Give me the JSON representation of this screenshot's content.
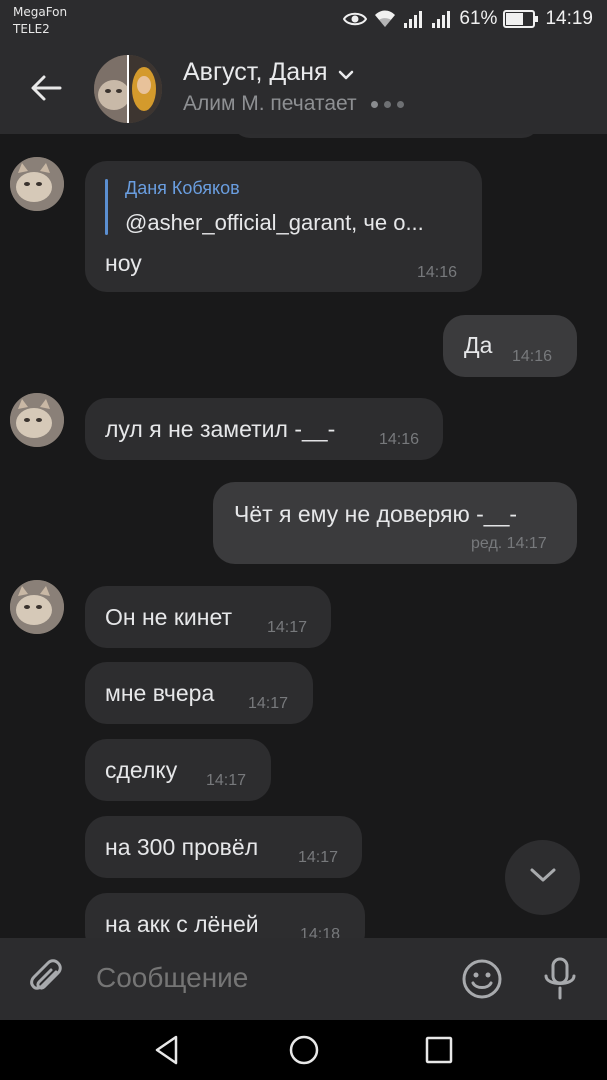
{
  "status_bar": {
    "carrier_1": "MegaFon",
    "carrier_2": "TELE2",
    "battery": "61%",
    "time": "14:19"
  },
  "header": {
    "title": "Август, Даня",
    "subtitle": "Алим М. печатает"
  },
  "messages": [
    {
      "side": "in",
      "reply_author": "Даня Кобяков",
      "reply_text": "@asher_official_garant, че о...",
      "text": "ноу",
      "time": "14:16"
    },
    {
      "side": "out",
      "text": "Да",
      "time": "14:16"
    },
    {
      "side": "in",
      "text": "лул я не заметил -__-",
      "time": "14:16"
    },
    {
      "side": "out",
      "text": "Чёт я ему не доверяю -__-",
      "time": "ред. 14:17"
    },
    {
      "side": "in",
      "text": "Он не кинет",
      "time": "14:17"
    },
    {
      "side": "in",
      "text": "мне вчера",
      "time": "14:17"
    },
    {
      "side": "in",
      "text": "сделку",
      "time": "14:17"
    },
    {
      "side": "in",
      "text": "на 300 провёл",
      "time": "14:17"
    },
    {
      "side": "in",
      "text": "на акк с лёней",
      "time": "14:18"
    }
  ],
  "composer": {
    "placeholder": "Сообщение"
  },
  "icons": {
    "back": "arrow-left-icon",
    "attach": "paperclip-icon",
    "emoji": "smiley-icon",
    "mic": "microphone-icon",
    "scroll_down": "chevron-down-icon"
  },
  "colors": {
    "bar_bg": "#2c2c2e",
    "chat_bg": "#19191a",
    "bubble_in": "#2d2d2f",
    "bubble_out": "#3b3b3d",
    "reply_accent": "#5b8fd1"
  }
}
